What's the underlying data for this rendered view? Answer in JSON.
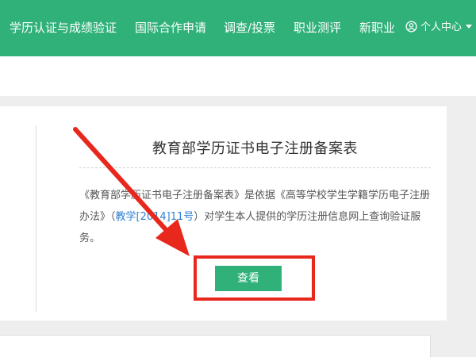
{
  "nav": {
    "items": [
      {
        "label": "学历认证与成绩验证"
      },
      {
        "label": "国际合作申请"
      },
      {
        "label": "调查/投票"
      },
      {
        "label": "职业测评"
      },
      {
        "label": "新职业"
      }
    ],
    "user_menu": {
      "label": "个人中心",
      "icon": "user-circle-icon"
    }
  },
  "card": {
    "title": "教育部学历证书电子注册备案表",
    "desc_part1": "《教育部学历证书电子注册备案表》是依据《高等学校学生学籍学历电子注册办法》（",
    "desc_link": "教学[2014]11号",
    "desc_part2": "）对学生本人提供的学历注册信息网上查询验证服务。",
    "view_button": "查看"
  },
  "colors": {
    "brand_green": "#2fb179",
    "annotation_red": "#e8271d",
    "link_blue": "#2f7fd0"
  }
}
